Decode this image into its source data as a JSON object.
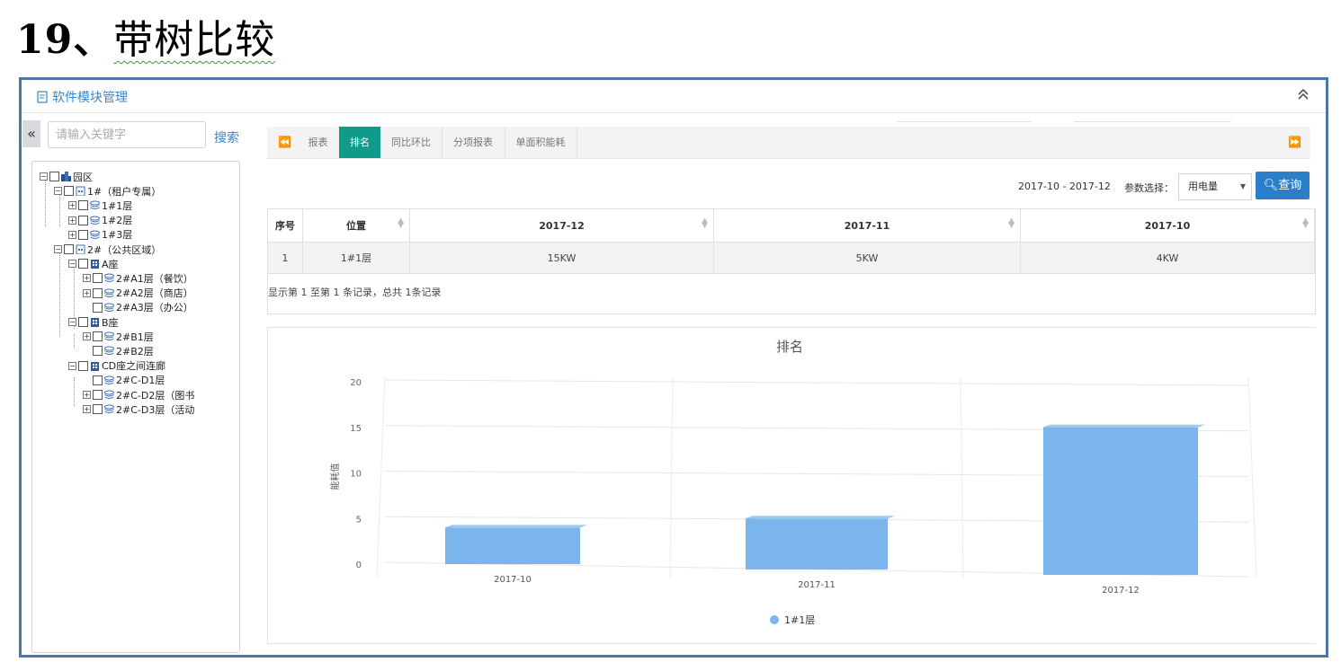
{
  "slide": {
    "number": "19、",
    "title": "带树比较"
  },
  "panel": {
    "title": "软件模块管理"
  },
  "sidebar": {
    "search_placeholder": "请输入关键字",
    "search_label": "搜索",
    "tree": [
      {
        "label": "园区"
      },
      {
        "label": "1#（租户专属）"
      },
      {
        "label": "1#1层"
      },
      {
        "label": "1#2层"
      },
      {
        "label": "1#3层"
      },
      {
        "label": "2#（公共区域）"
      },
      {
        "label": "A座"
      },
      {
        "label": "2#A1层（餐饮）"
      },
      {
        "label": "2#A2层（商店）"
      },
      {
        "label": "2#A3层（办公）"
      },
      {
        "label": "B座"
      },
      {
        "label": "2#B1层"
      },
      {
        "label": "2#B2层"
      },
      {
        "label": "CD座之间连廊"
      },
      {
        "label": "2#C-D1层"
      },
      {
        "label": "2#C-D2层（图书"
      },
      {
        "label": "2#C-D3层（活动"
      }
    ]
  },
  "tabs": [
    {
      "label": "报表"
    },
    {
      "label": "排名"
    },
    {
      "label": "同比环比"
    },
    {
      "label": "分项报表"
    },
    {
      "label": "单面积能耗"
    }
  ],
  "filters": {
    "date_range": "2017-10 - 2017-12",
    "param_label": "参数选择：",
    "param_value": "用电量",
    "query_label": "查询"
  },
  "table": {
    "headers": [
      "序号",
      "位置",
      "2017-12",
      "2017-11",
      "2017-10"
    ],
    "rows": [
      [
        "1",
        "1#1层",
        "15KW",
        "5KW",
        "4KW"
      ]
    ],
    "footer": "显示第 1 至第 1 条记录，总共 1条记录"
  },
  "chart_data": {
    "type": "bar",
    "title": "排名",
    "categories": [
      "2017-10",
      "2017-11",
      "2017-12"
    ],
    "series": [
      {
        "name": "1#1层",
        "values": [
          4,
          5,
          15
        ],
        "color": "#7cb5ec"
      }
    ],
    "ylabel": "能耗值",
    "ylim": [
      0,
      20
    ],
    "yticks": [
      "0",
      "5",
      "10",
      "15",
      "20"
    ],
    "grid": true,
    "legend": "bottom-center"
  }
}
